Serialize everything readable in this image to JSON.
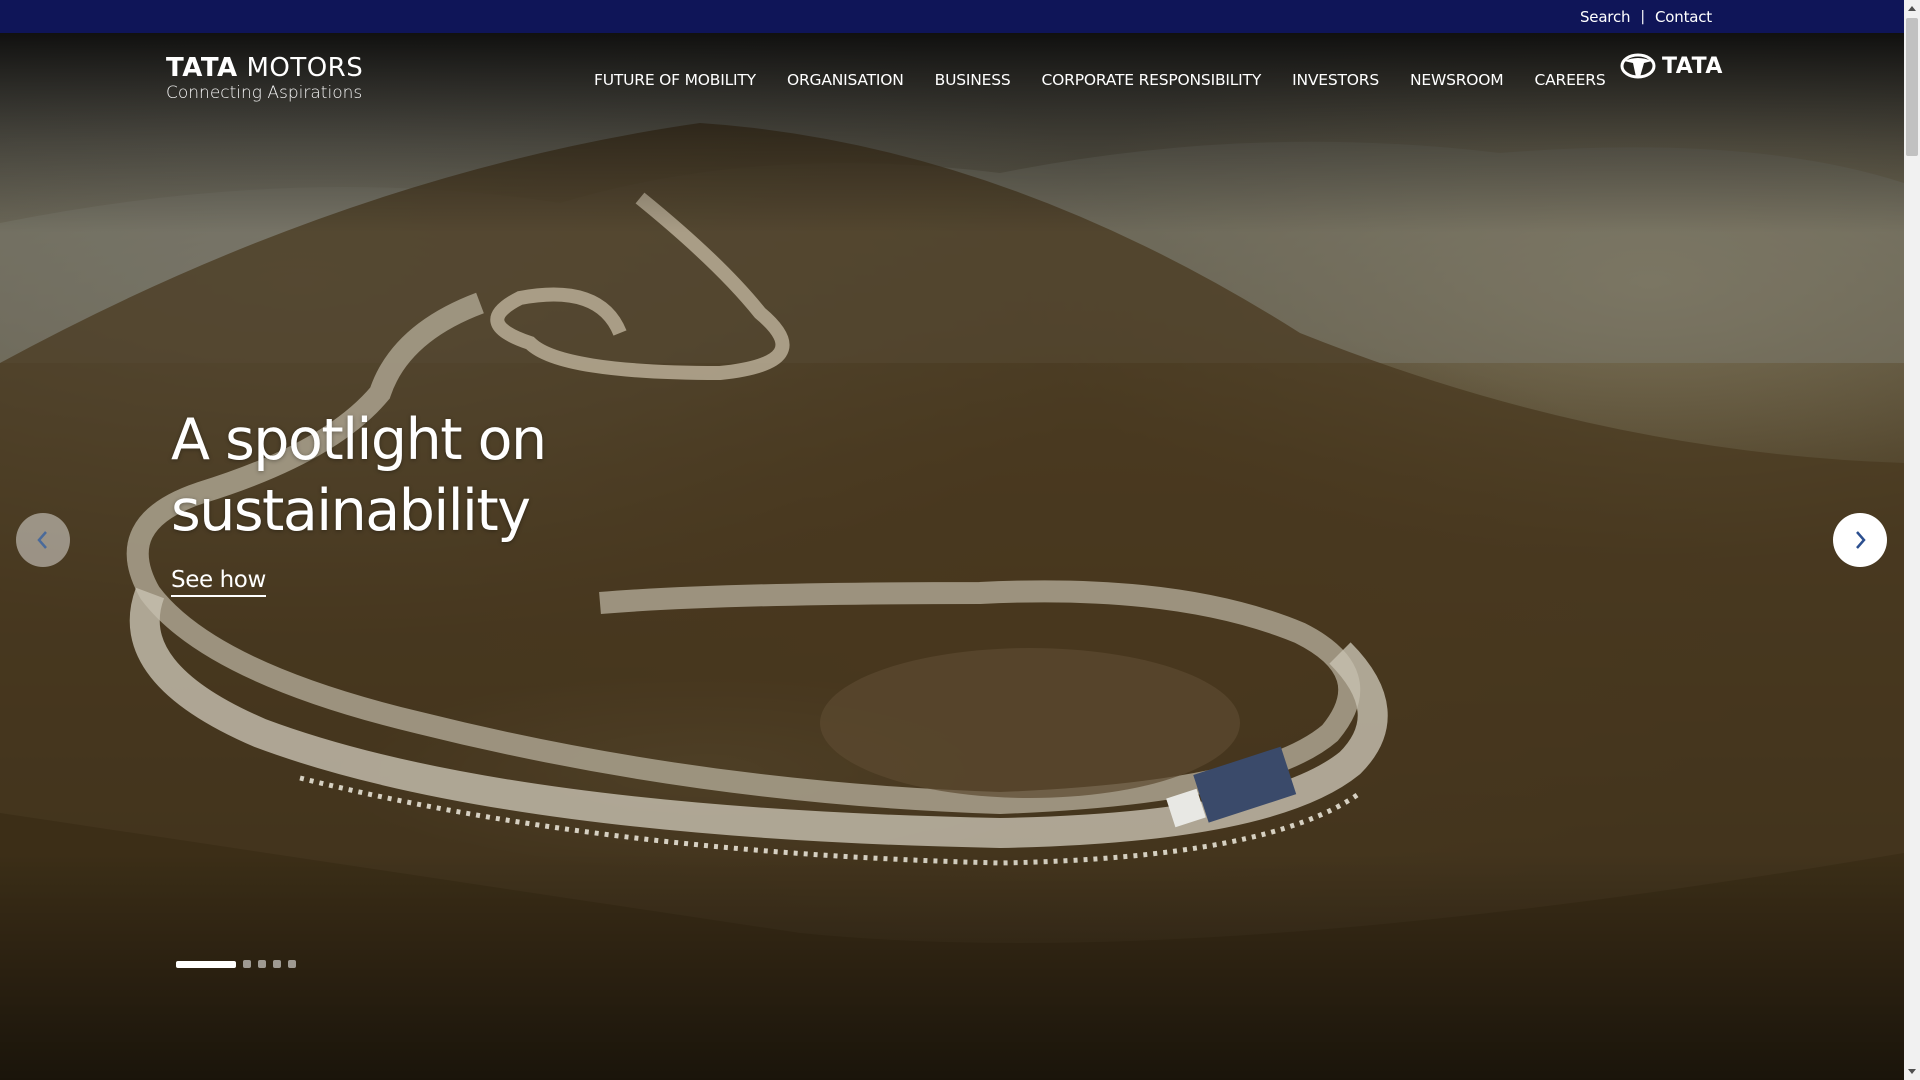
{
  "utility_nav": {
    "search_label": "Search",
    "separator": "|",
    "contact_label": "Contact"
  },
  "brand": {
    "name_bold": "TATA",
    "name_regular": "MOTORS",
    "tagline": "Connecting Aspirations",
    "group_logo_text": "TATA"
  },
  "main_nav": {
    "items": [
      {
        "label": "FUTURE OF MOBILITY"
      },
      {
        "label": "ORGANISATION"
      },
      {
        "label": "BUSINESS"
      },
      {
        "label": "CORPORATE RESPONSIBILITY"
      },
      {
        "label": "INVESTORS"
      },
      {
        "label": "NEWSROOM"
      },
      {
        "label": "CAREERS"
      }
    ]
  },
  "hero": {
    "title": "A spotlight on sustainability",
    "cta_label": "See how",
    "slide_count": 5,
    "active_slide": 1
  },
  "icons": {
    "prev": "chevron-left-icon",
    "next": "chevron-right-icon",
    "logo": "tata-logo-icon"
  },
  "colors": {
    "utility_bar": "#0f1558",
    "arrow_icon": "#2c4f8f",
    "text": "#ffffff"
  }
}
